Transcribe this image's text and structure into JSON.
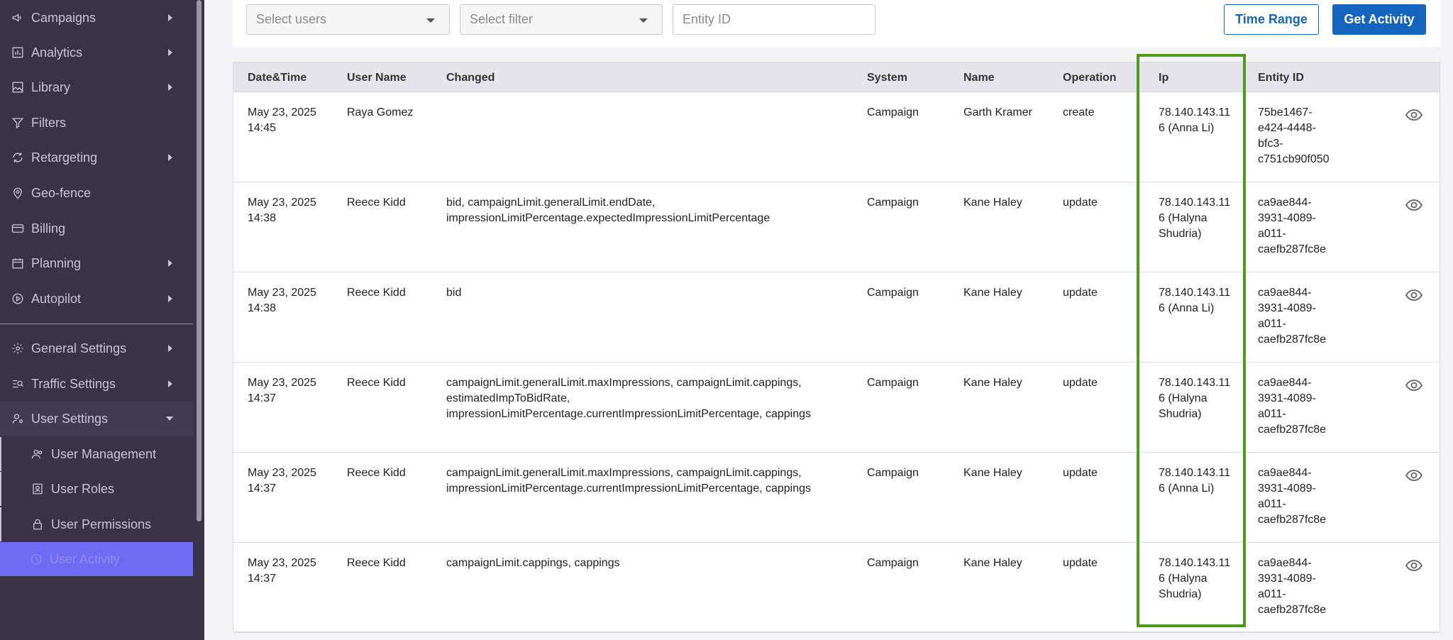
{
  "sidebar": {
    "items": [
      {
        "label": "Campaigns",
        "icon": "megaphone-icon",
        "arrow": true
      },
      {
        "label": "Analytics",
        "icon": "bar-chart-icon",
        "arrow": true
      },
      {
        "label": "Library",
        "icon": "image-icon",
        "arrow": true
      },
      {
        "label": "Filters",
        "icon": "filter-icon",
        "arrow": false
      },
      {
        "label": "Retargeting",
        "icon": "refresh-icon",
        "arrow": true
      },
      {
        "label": "Geo-fence",
        "icon": "map-pin-icon",
        "arrow": false
      },
      {
        "label": "Billing",
        "icon": "credit-card-icon",
        "arrow": false
      },
      {
        "label": "Planning",
        "icon": "calendar-icon",
        "arrow": true
      },
      {
        "label": "Autopilot",
        "icon": "play-circle-icon",
        "arrow": true
      }
    ],
    "settings": [
      {
        "label": "General Settings",
        "icon": "gear-icon"
      },
      {
        "label": "Traffic Settings",
        "icon": "traffic-icon"
      },
      {
        "label": "User Settings",
        "icon": "user-settings-icon"
      }
    ],
    "sub_items": [
      {
        "label": "User Management",
        "icon": "users-icon"
      },
      {
        "label": "User Roles",
        "icon": "id-badge-icon"
      },
      {
        "label": "User Permissions",
        "icon": "lock-icon"
      },
      {
        "label": "User Activity",
        "icon": "clock-icon"
      }
    ]
  },
  "filters": {
    "users_placeholder": "Select users",
    "filter_placeholder": "Select filter",
    "entity_placeholder": "Entity ID",
    "time_range_label": "Time Range",
    "get_activity_label": "Get Activity"
  },
  "table": {
    "headers": [
      "Date&Time",
      "User Name",
      "Changed",
      "System",
      "Name",
      "Operation",
      "Ip",
      "Entity ID"
    ],
    "rows": [
      {
        "date": "May 23, 2025",
        "time": "14:45",
        "user": "Raya Gomez",
        "changed": [],
        "system": "Campaign",
        "name": "Garth Kramer",
        "operation": "create",
        "ip": [
          "78.140.143.11",
          "6 (Anna Li)"
        ],
        "entity": [
          "75be1467-",
          "e424-4448-",
          "bfc3-",
          "c751cb90f050"
        ]
      },
      {
        "date": "May 23, 2025",
        "time": "14:38",
        "user": "Reece Kidd",
        "changed": [
          "bid, campaignLimit.generalLimit.endDate,",
          "impressionLimitPercentage.expectedImpressionLimitPercentage"
        ],
        "system": "Campaign",
        "name": "Kane Haley",
        "operation": "update",
        "ip": [
          "78.140.143.11",
          "6 (Halyna",
          "Shudria)"
        ],
        "entity": [
          "ca9ae844-",
          "3931-4089-",
          "a011-",
          "caefb287fc8e"
        ]
      },
      {
        "date": "May 23, 2025",
        "time": "14:38",
        "user": "Reece Kidd",
        "changed": [
          "bid"
        ],
        "system": "Campaign",
        "name": "Kane Haley",
        "operation": "update",
        "ip": [
          "78.140.143.11",
          "6 (Anna Li)"
        ],
        "entity": [
          "ca9ae844-",
          "3931-4089-",
          "a011-",
          "caefb287fc8e"
        ]
      },
      {
        "date": "May 23, 2025",
        "time": "14:37",
        "user": "Reece Kidd",
        "changed": [
          "campaignLimit.generalLimit.maxImpressions, campaignLimit.cappings,",
          "estimatedImpToBidRate,",
          "impressionLimitPercentage.currentImpressionLimitPercentage, cappings"
        ],
        "system": "Campaign",
        "name": "Kane Haley",
        "operation": "update",
        "ip": [
          "78.140.143.11",
          "6 (Halyna",
          "Shudria)"
        ],
        "entity": [
          "ca9ae844-",
          "3931-4089-",
          "a011-",
          "caefb287fc8e"
        ]
      },
      {
        "date": "May 23, 2025",
        "time": "14:37",
        "user": "Reece Kidd",
        "changed": [
          "campaignLimit.generalLimit.maxImpressions, campaignLimit.cappings,",
          "impressionLimitPercentage.currentImpressionLimitPercentage, cappings"
        ],
        "system": "Campaign",
        "name": "Kane Haley",
        "operation": "update",
        "ip": [
          "78.140.143.11",
          "6 (Anna Li)"
        ],
        "entity": [
          "ca9ae844-",
          "3931-4089-",
          "a011-",
          "caefb287fc8e"
        ]
      },
      {
        "date": "May 23, 2025",
        "time": "14:37",
        "user": "Reece Kidd",
        "changed": [
          "campaignLimit.cappings, cappings"
        ],
        "system": "Campaign",
        "name": "Kane Haley",
        "operation": "update",
        "ip": [
          "78.140.143.11",
          "6 (Halyna",
          "Shudria)"
        ],
        "entity": [
          "ca9ae844-",
          "3931-4089-",
          "a011-",
          "caefb287fc8e"
        ]
      }
    ]
  },
  "colors": {
    "sidebar_bg": "#3a3349",
    "accent": "#1565c0",
    "active_item": "#6e6cf0",
    "highlight_box": "#4e9a1c"
  }
}
